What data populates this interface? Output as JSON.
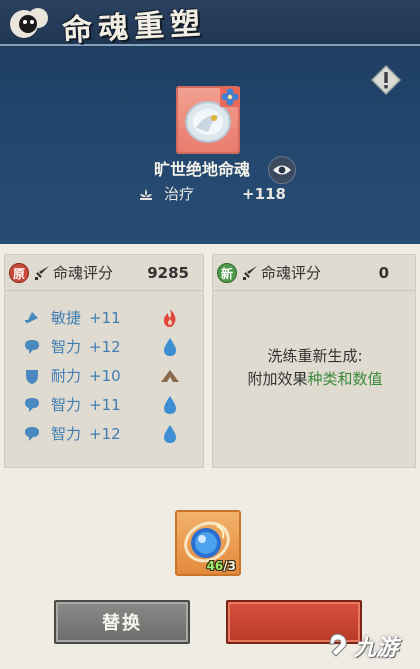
{
  "header": {
    "title": "命魂重塑"
  },
  "soul": {
    "name": "旷世绝地命魂",
    "stat_label": "治疗",
    "stat_value": "+118"
  },
  "original_panel": {
    "tag": "原",
    "label": "命魂评分",
    "score": "9285",
    "attributes": [
      {
        "name": "敏捷",
        "value": "+11",
        "element": "fire-icon",
        "element_color": "#e0483a"
      },
      {
        "name": "智力",
        "value": "+12",
        "element": "water-drop-icon",
        "element_color": "#3d8ed2"
      },
      {
        "name": "耐力",
        "value": "+10",
        "element": "mountain-icon",
        "element_color": "#8a6a4a"
      },
      {
        "name": "智力",
        "value": "+11",
        "element": "water-drop-icon",
        "element_color": "#3d8ed2"
      },
      {
        "name": "智力",
        "value": "+12",
        "element": "water-drop-icon",
        "element_color": "#3d8ed2"
      }
    ]
  },
  "new_panel": {
    "tag": "新",
    "label": "命魂评分",
    "score": "0",
    "refine_line1": "洗练重新生成:",
    "refine_line2_prefix": "附加效果",
    "refine_line2_highlight": "种类和数值"
  },
  "material": {
    "have": "46",
    "need": "/3"
  },
  "buttons": {
    "replace_label": "替换"
  },
  "watermark": {
    "text": "九游"
  },
  "colors": {
    "attribute_text": "#3f7db3",
    "highlight_green": "#3e8a3b",
    "top_background": "#23466d"
  }
}
